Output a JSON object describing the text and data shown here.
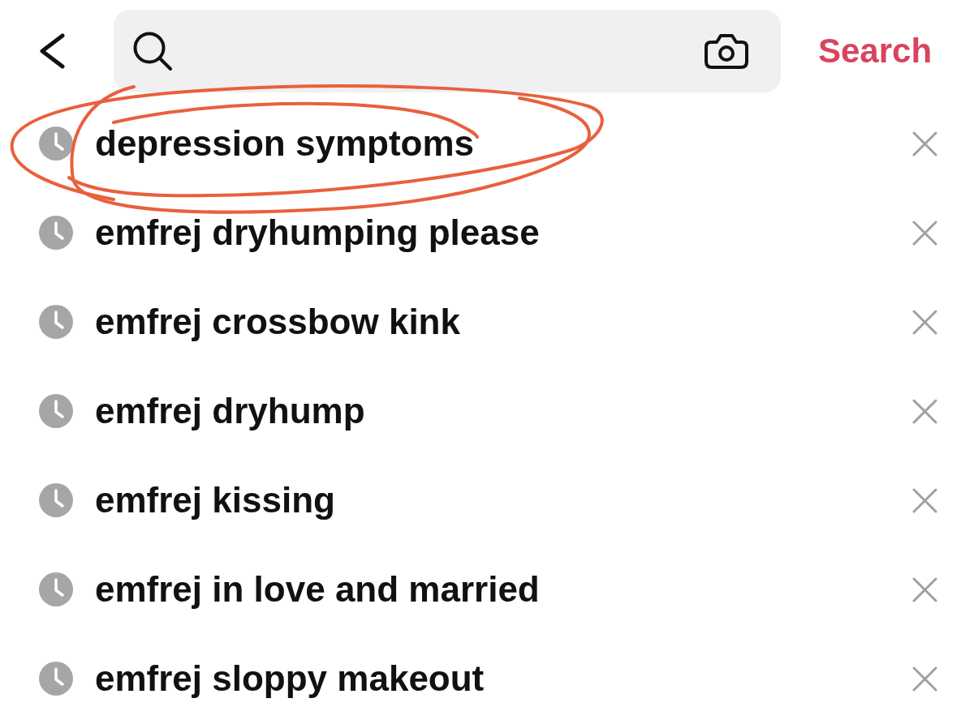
{
  "search_button": "Search",
  "recent_searches": [
    {
      "text": "depression symptoms",
      "circled": true
    },
    {
      "text": "emfrej dryhumping please",
      "circled": false
    },
    {
      "text": "emfrej crossbow kink",
      "circled": false
    },
    {
      "text": "emfrej dryhump",
      "circled": false
    },
    {
      "text": "emfrej kissing",
      "circled": false
    },
    {
      "text": "emfrej in love and married",
      "circled": false
    },
    {
      "text": "emfrej sloppy makeout",
      "circled": false
    }
  ]
}
